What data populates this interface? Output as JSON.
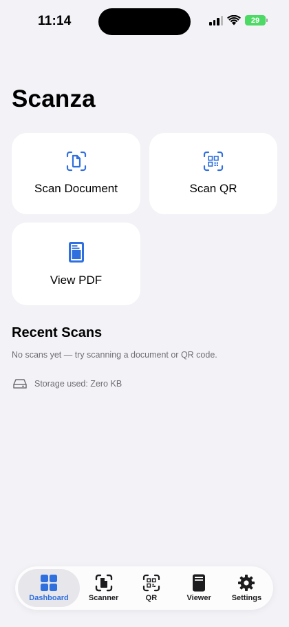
{
  "status_bar": {
    "time": "11:14",
    "battery": "29"
  },
  "app": {
    "title": "Scanza"
  },
  "actions": [
    {
      "label": "Scan Document",
      "icon": "scan-document-icon"
    },
    {
      "label": "Scan QR",
      "icon": "qr-scan-icon"
    },
    {
      "label": "View PDF",
      "icon": "pdf-document-icon"
    }
  ],
  "recent": {
    "title": "Recent Scans",
    "empty_message": "No scans yet — try scanning a document or QR code."
  },
  "storage": {
    "label": "Storage used: Zero KB",
    "icon": "storage-drive-icon"
  },
  "tab_bar": {
    "items": [
      {
        "label": "Dashboard",
        "icon": "dashboard-grid-icon",
        "active": true
      },
      {
        "label": "Scanner",
        "icon": "scanner-icon",
        "active": false
      },
      {
        "label": "QR",
        "icon": "qr-code-icon",
        "active": false
      },
      {
        "label": "Viewer",
        "icon": "viewer-document-icon",
        "active": false
      },
      {
        "label": "Settings",
        "icon": "gear-icon",
        "active": false
      }
    ]
  },
  "colors": {
    "accent": "#2f6fde",
    "background": "#f2f2f7",
    "card": "#ffffff",
    "secondary_text": "#6e6e73",
    "battery": "#4cd964"
  }
}
